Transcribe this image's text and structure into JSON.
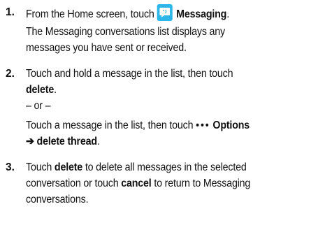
{
  "steps": [
    {
      "number": "1.",
      "text_before_icon": "From the Home screen, touch",
      "icon_label": "Messaging",
      "punct": ".",
      "desc_line1": "The Messaging conversations list displays any",
      "desc_line2": "messages you have sent or received."
    },
    {
      "number": "2.",
      "line1": "Touch and hold a message in the list, then touch",
      "delete_word": "delete",
      "punct": ".",
      "or_text": "– or –",
      "alt_line1_prefix": "Touch a message in the list, then touch",
      "options_dots": "•••",
      "options_label": "Options",
      "arrow": "➔",
      "delete_thread": "delete thread",
      "alt_punct": "."
    },
    {
      "number": "3.",
      "touch": "Touch",
      "delete_word": "delete",
      "line1_rest": "to delete all messages in the selected",
      "line2_prefix": "conversation or touch",
      "cancel_word": "cancel",
      "line2_rest": "to return to Messaging",
      "line3": "conversations."
    }
  ]
}
